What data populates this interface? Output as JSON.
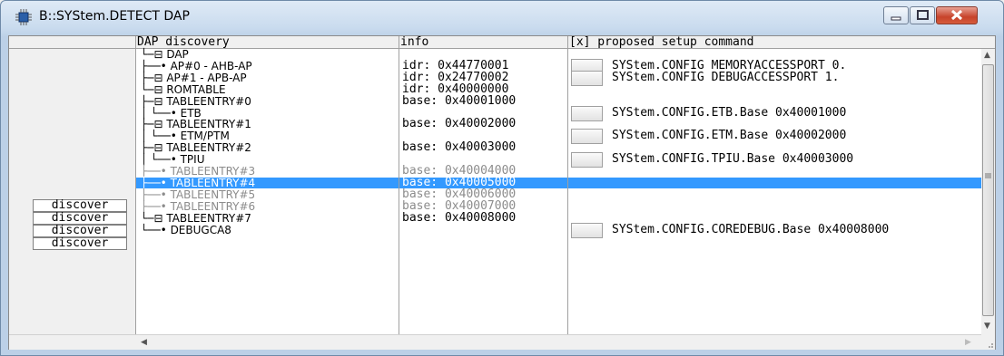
{
  "window": {
    "title": "B::SYStem.DETECT DAP"
  },
  "columns": {
    "dap_discovery": "DAP discovery",
    "info": "info",
    "proposed": "[x] proposed setup command"
  },
  "discover_buttons": [
    "discover",
    "discover",
    "discover",
    "discover"
  ],
  "rows": [
    {
      "tree": "└─⊟ DAP",
      "info": "",
      "cmd": "",
      "has_btn": false,
      "style": ""
    },
    {
      "tree": "    ├──• AP#0 - AHB-AP",
      "info": "idr: 0x44770001",
      "cmd": "SYStem.CONFIG MEMORYACCESSPORT 0.",
      "has_btn": true,
      "style": ""
    },
    {
      "tree": "    ├─⊟ AP#1 - APB-AP",
      "info": "idr: 0x24770002",
      "cmd": "SYStem.CONFIG DEBUGACCESSPORT 1.",
      "has_btn": true,
      "style": ""
    },
    {
      "tree": "        └─⊟ ROMTABLE",
      "info": "idr: 0x40000000",
      "cmd": "",
      "has_btn": false,
      "style": ""
    },
    {
      "tree": "            ├─⊟ TABLEENTRY#0",
      "info": "base: 0x40001000",
      "cmd": "",
      "has_btn": false,
      "style": ""
    },
    {
      "tree": "            │   └──• ETB",
      "info": "",
      "cmd": "SYStem.CONFIG.ETB.Base 0x40001000",
      "has_btn": true,
      "style": ""
    },
    {
      "tree": "            ├─⊟ TABLEENTRY#1",
      "info": "base: 0x40002000",
      "cmd": "",
      "has_btn": false,
      "style": ""
    },
    {
      "tree": "            │   └──• ETM/PTM",
      "info": "",
      "cmd": "SYStem.CONFIG.ETM.Base 0x40002000",
      "has_btn": true,
      "style": ""
    },
    {
      "tree": "            ├─⊟ TABLEENTRY#2",
      "info": "base: 0x40003000",
      "cmd": "",
      "has_btn": false,
      "style": ""
    },
    {
      "tree": "            │   └──• TPIU",
      "info": "",
      "cmd": "SYStem.CONFIG.TPIU.Base 0x40003000",
      "has_btn": true,
      "style": ""
    },
    {
      "tree": "            ├──• TABLEENTRY#3",
      "info": "base: 0x40004000",
      "cmd": "",
      "has_btn": false,
      "style": "gray"
    },
    {
      "tree": "            ├──• TABLEENTRY#4",
      "info": "base: 0x40005000",
      "cmd": "",
      "has_btn": false,
      "style": "sel"
    },
    {
      "tree": "            ├──• TABLEENTRY#5",
      "info": "base: 0x40006000",
      "cmd": "",
      "has_btn": false,
      "style": "gray"
    },
    {
      "tree": "            ├──• TABLEENTRY#6",
      "info": "base: 0x40007000",
      "cmd": "",
      "has_btn": false,
      "style": "gray"
    },
    {
      "tree": "            └─⊟ TABLEENTRY#7",
      "info": "base: 0x40008000",
      "cmd": "",
      "has_btn": false,
      "style": ""
    },
    {
      "tree": "                └──• DEBUGCA8",
      "info": "",
      "cmd": "SYStem.CONFIG.COREDEBUG.Base 0x40008000",
      "has_btn": true,
      "style": ""
    }
  ],
  "icons": {
    "app": "chip-icon",
    "minimize": "minimize-icon",
    "maximize": "maximize-icon",
    "close": "close-icon"
  },
  "colors": {
    "selection": "#3399ff",
    "disabled_text": "#8c8c8c",
    "close_button": "#c7432b"
  }
}
